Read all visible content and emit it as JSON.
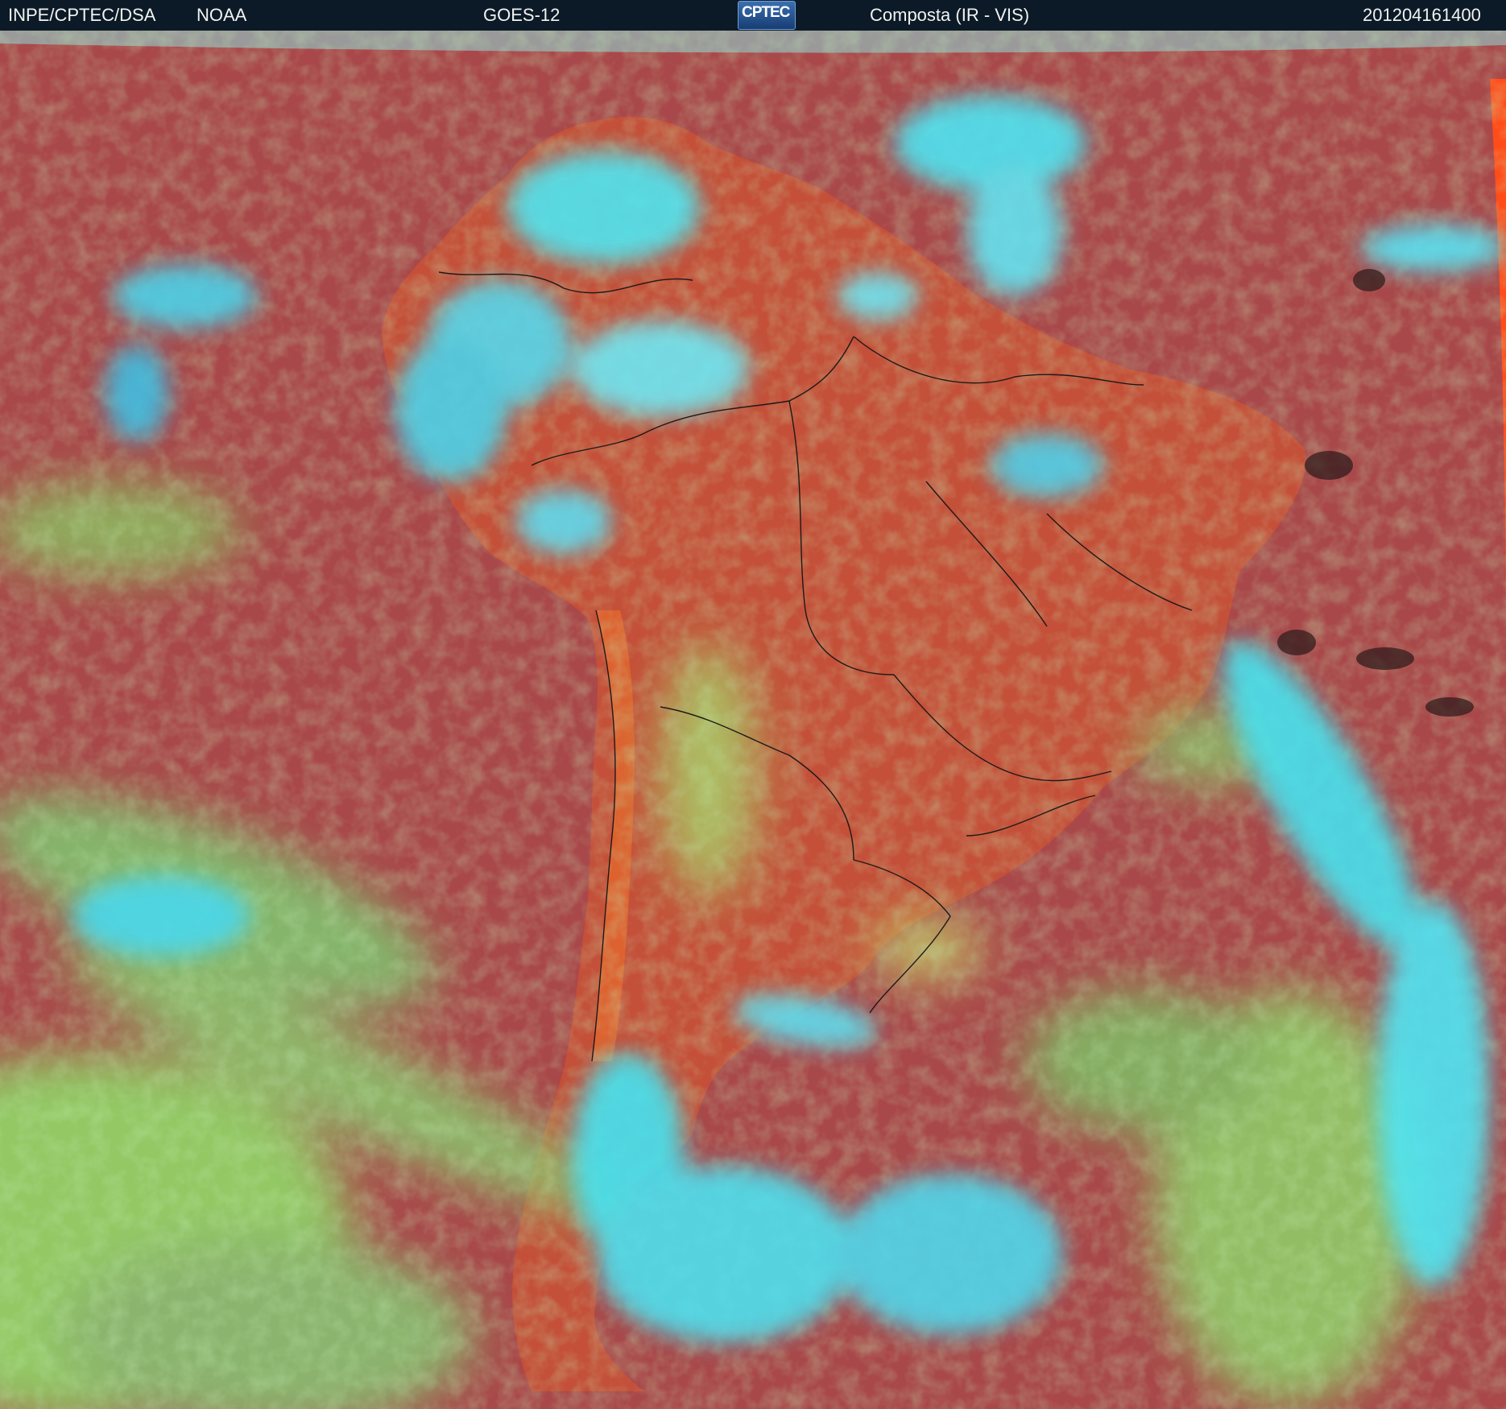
{
  "header": {
    "agency": "INPE/CPTEC/DSA",
    "source": "NOAA",
    "satellite": "GOES-12",
    "logo_text": "CPTEC",
    "product": "Composta (IR - VIS)",
    "timestamp": "201204161400"
  },
  "colors": {
    "header_bg": "#0b1a26",
    "ocean_clear": "#b24a44",
    "land_clear": "#c9553a",
    "low_cloud": "#8fd46a",
    "high_cloud": "#35e0ee",
    "no_data": "#9a9a9a",
    "borders": "#1a1a1a"
  },
  "icons": [
    "cptec-logo-icon"
  ]
}
